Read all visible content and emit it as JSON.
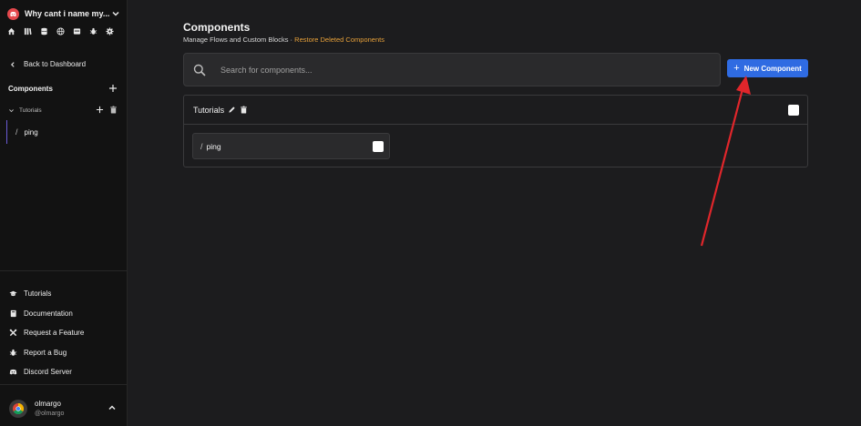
{
  "workspace": {
    "name": "Why cant i name my..."
  },
  "sidebar": {
    "top_icons": [
      "home-icon",
      "library-icon",
      "database-icon",
      "globe-icon",
      "layout-icon",
      "bug-icon",
      "gear-icon"
    ],
    "back_label": "Back to Dashboard",
    "components_title": "Components",
    "folder": {
      "label": "Tutorials"
    },
    "file": {
      "label": "ping"
    },
    "footer_links": [
      {
        "label": "Tutorials",
        "icon": "graduation-cap-icon"
      },
      {
        "label": "Documentation",
        "icon": "book-icon"
      },
      {
        "label": "Request a Feature",
        "icon": "tools-icon"
      },
      {
        "label": "Report a Bug",
        "icon": "bug-icon"
      },
      {
        "label": "Discord Server",
        "icon": "discord-icon"
      }
    ],
    "user": {
      "name": "olmargo",
      "handle": "@olmargo"
    }
  },
  "main": {
    "title": "Components",
    "subtitle": "Manage Flows and Custom Blocks ·",
    "restore_link": "Restore Deleted Components",
    "search": {
      "placeholder": "Search for components...",
      "value": ""
    },
    "new_button": "New Component",
    "folder": {
      "name": "Tutorials",
      "items": [
        {
          "label": "ping"
        }
      ]
    }
  },
  "colors": {
    "accent_button": "#2f6be2",
    "link": "#e6a03a",
    "annotation_arrow": "#e0262b",
    "logo": "#e5484d"
  }
}
